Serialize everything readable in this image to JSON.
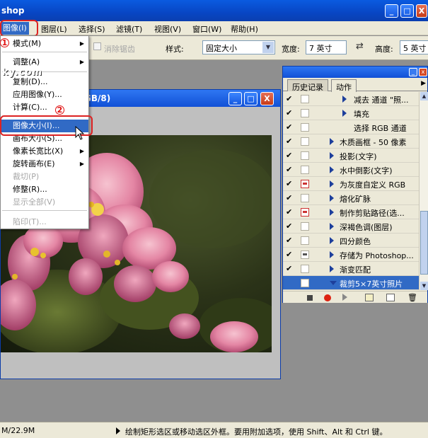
{
  "window": {
    "title": "shop",
    "buttons": {
      "minimize": "_",
      "maximize": "□",
      "close": "X"
    }
  },
  "menubar": {
    "items": [
      {
        "label": "图像(I)"
      },
      {
        "label": "图层(L)"
      },
      {
        "label": "选择(S)"
      },
      {
        "label": "滤镜(T)"
      },
      {
        "label": "视图(V)"
      },
      {
        "label": "窗口(W)"
      },
      {
        "label": "帮助(H)"
      }
    ]
  },
  "options": {
    "antialias_label": "消除锯齿",
    "style_label": "样式:",
    "style_value": "固定大小",
    "width_label": "宽度:",
    "width_value": "7 英寸",
    "height_label": "高度:",
    "height_value": "5 英寸",
    "swap_icon": "swap-arrows"
  },
  "dropdown": {
    "items": [
      {
        "label": "模式(M)",
        "submenu": true,
        "disabled": false
      },
      {
        "label": "调整(A)",
        "submenu": true,
        "disabled": false
      },
      {
        "label": "复制(D)...",
        "submenu": false,
        "disabled": false
      },
      {
        "label": "应用图像(Y)...",
        "submenu": false,
        "disabled": false
      },
      {
        "label": "计算(C)...",
        "submenu": false,
        "disabled": false
      },
      {
        "label": "图像大小(I)...",
        "submenu": false,
        "disabled": false,
        "highlighted": true
      },
      {
        "label": "画布大小(S)...",
        "submenu": false,
        "disabled": false
      },
      {
        "label": "像素长宽比(X)",
        "submenu": true,
        "disabled": false
      },
      {
        "label": "旋转画布(E)",
        "submenu": true,
        "disabled": false
      },
      {
        "label": "裁切(P)",
        "submenu": false,
        "disabled": true
      },
      {
        "label": "修整(R)...",
        "submenu": false,
        "disabled": false
      },
      {
        "label": "显示全部(V)",
        "submenu": false,
        "disabled": true
      },
      {
        "label": "陷印(T)...",
        "submenu": false,
        "disabled": true
      }
    ],
    "annotation_1": "1",
    "annotation_2": "2"
  },
  "watermark": "ky.com",
  "document": {
    "title": "GB/8)"
  },
  "panel": {
    "tabs": [
      "历史记录",
      "动作"
    ],
    "active_tab": "动作",
    "rows": [
      {
        "label": "减去 通道 \"照...",
        "checked": true,
        "dialog": "none",
        "indent": 2,
        "expanded": false
      },
      {
        "label": "填充",
        "checked": true,
        "dialog": "none",
        "indent": 2,
        "expanded": false
      },
      {
        "label": "选择 RGB 通道",
        "checked": true,
        "dialog": "none",
        "indent": 2,
        "expanded": false,
        "no_triangle": true
      },
      {
        "label": "木质画框 - 50 像素",
        "checked": true,
        "dialog": "none",
        "indent": 1,
        "expanded": false
      },
      {
        "label": "投影(文字)",
        "checked": true,
        "dialog": "none",
        "indent": 1,
        "expanded": false
      },
      {
        "label": "水中倒影(文字)",
        "checked": true,
        "dialog": "none",
        "indent": 1,
        "expanded": false
      },
      {
        "label": "为灰度自定义 RGB",
        "checked": true,
        "dialog": "red",
        "indent": 1,
        "expanded": false
      },
      {
        "label": "熔化矿脉",
        "checked": true,
        "dialog": "none",
        "indent": 1,
        "expanded": false
      },
      {
        "label": "制作剪贴路径(选...",
        "checked": true,
        "dialog": "red",
        "indent": 1,
        "expanded": false
      },
      {
        "label": "深褐色调(图层)",
        "checked": true,
        "dialog": "none",
        "indent": 1,
        "expanded": false
      },
      {
        "label": "四分颜色",
        "checked": true,
        "dialog": "none",
        "indent": 1,
        "expanded": false
      },
      {
        "label": "存储为 Photoshop...",
        "checked": true,
        "dialog": "dark",
        "indent": 1,
        "expanded": false
      },
      {
        "label": "渐变匹配",
        "checked": true,
        "dialog": "none",
        "indent": 1,
        "expanded": false
      },
      {
        "label": "裁剪5×7英寸照片",
        "checked": false,
        "dialog": "none",
        "indent": 1,
        "expanded": true,
        "selected": true
      }
    ]
  },
  "statusbar": {
    "doc_size": "M/22.9M",
    "hint": "绘制矩形选区或移动选区外框。要用附加选项，使用 Shift、Alt 和 Ctrl 键。"
  }
}
